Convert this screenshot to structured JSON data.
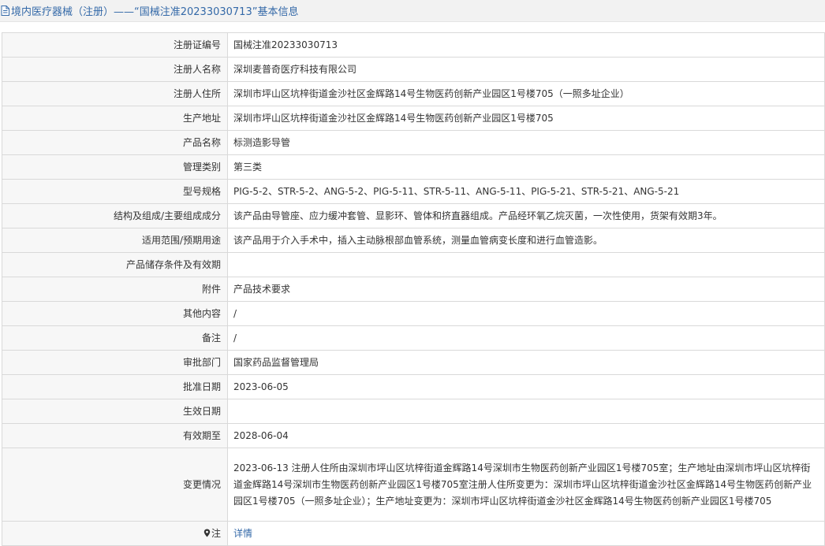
{
  "header": {
    "title": "境内医疗器械（注册）——“国械注准20233030713”基本信息",
    "icon": "document-icon"
  },
  "rows": [
    {
      "label": "注册证编号",
      "value": "国械注准20233030713"
    },
    {
      "label": "注册人名称",
      "value": "深圳麦普奇医疗科技有限公司"
    },
    {
      "label": "注册人住所",
      "value": "深圳市坪山区坑梓街道金沙社区金辉路14号生物医药创新产业园区1号楼705（一照多址企业）"
    },
    {
      "label": "生产地址",
      "value": "深圳市坪山区坑梓街道金沙社区金辉路14号生物医药创新产业园区1号楼705"
    },
    {
      "label": "产品名称",
      "value": "标测造影导管"
    },
    {
      "label": "管理类别",
      "value": "第三类"
    },
    {
      "label": "型号规格",
      "value": "PIG-5-2、STR-5-2、ANG-5-2、PIG-5-11、STR-5-11、ANG-5-11、PIG-5-21、STR-5-21、ANG-5-21"
    },
    {
      "label": "结构及组成/主要组成成分",
      "value": "该产品由导管座、应力缓冲套管、显影环、管体和挤直器组成。产品经环氧乙烷灭菌，一次性使用，货架有效期3年。"
    },
    {
      "label": "适用范围/预期用途",
      "value": "该产品用于介入手术中，插入主动脉根部血管系统，测量血管病变长度和进行血管造影。"
    },
    {
      "label": "产品储存条件及有效期",
      "value": ""
    },
    {
      "label": "附件",
      "value": "产品技术要求"
    },
    {
      "label": "其他内容",
      "value": "/"
    },
    {
      "label": "备注",
      "value": "/"
    },
    {
      "label": "审批部门",
      "value": "国家药品监督管理局"
    },
    {
      "label": "批准日期",
      "value": "2023-06-05"
    },
    {
      "label": "生效日期",
      "value": ""
    },
    {
      "label": "有效期至",
      "value": "2028-06-04"
    },
    {
      "label": "变更情况",
      "value": "2023-06-13 注册人住所由深圳市坪山区坑梓街道金辉路14号深圳市生物医药创新产业园区1号楼705室；生产地址由深圳市坪山区坑梓街道金辉路14号深圳市生物医药创新产业园区1号楼705室注册人住所变更为：深圳市坪山区坑梓街道金沙社区金辉路14号生物医药创新产业园区1号楼705（一照多址企业）；生产地址变更为：深圳市坪山区坑梓街道金沙社区金辉路14号生物医药创新产业园区1号楼705"
    }
  ],
  "note_row": {
    "label": "注",
    "icon": "map-pin-icon",
    "link": "详情"
  },
  "colors": {
    "link": "#3469a8",
    "label_bg": "#f7f7f7",
    "border": "#d9d9d9",
    "title_bg": "#f2f2f2"
  }
}
